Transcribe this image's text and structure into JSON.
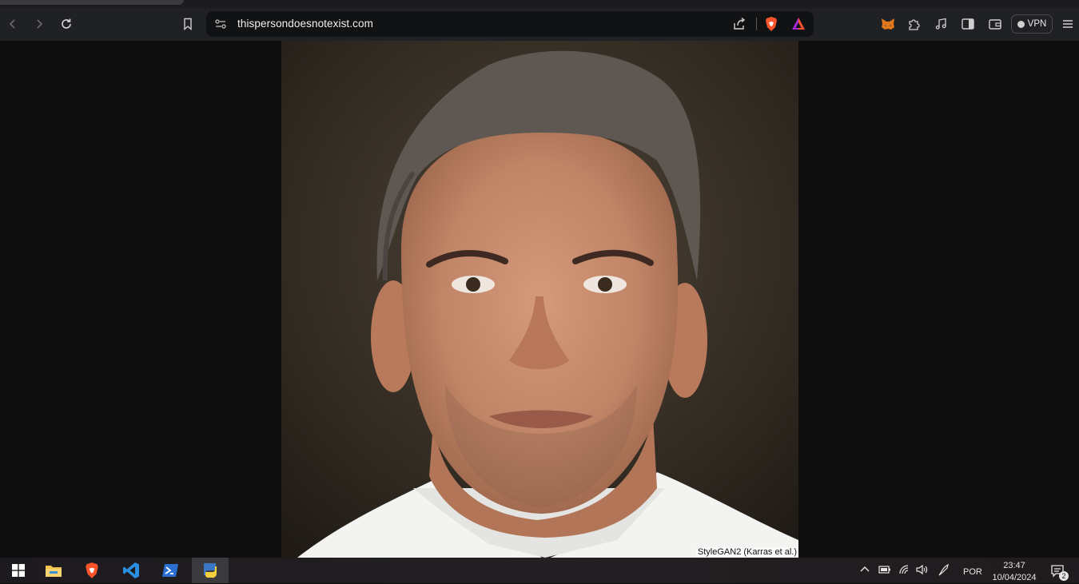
{
  "browser": {
    "url": "thispersondoesnotexist.com",
    "vpn_label": "VPN"
  },
  "page": {
    "caption": "StyleGAN2 (Karras et al.)"
  },
  "taskbar": {
    "apps": [
      {
        "name": "file-explorer",
        "active": false
      },
      {
        "name": "brave-browser",
        "active": false
      },
      {
        "name": "vscode",
        "active": false
      },
      {
        "name": "powershell",
        "active": false
      },
      {
        "name": "python",
        "active": true
      }
    ],
    "language": "POR",
    "time": "23:47",
    "date": "10/04/2024",
    "notification_count": "2"
  },
  "colors": {
    "toolbar_bg": "#202124",
    "urlbar_bg": "#111214",
    "page_bg": "#0e0e0e",
    "brave_orange": "#fb542b",
    "vscode_blue": "#2a8fe0"
  }
}
